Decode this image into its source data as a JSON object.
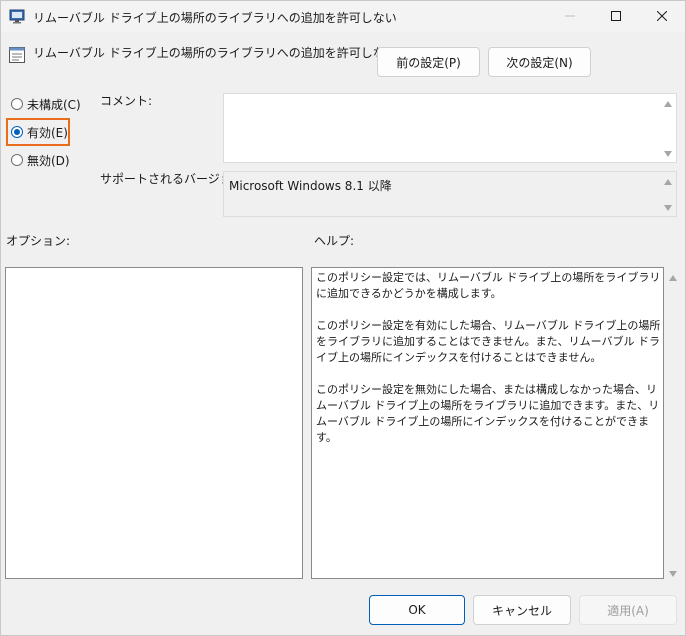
{
  "window": {
    "title": "リムーバブル ドライブ上の場所のライブラリへの追加を許可しない"
  },
  "header": {
    "policy_name": "リムーバブル ドライブ上の場所のライブラリへの追加を許可しない",
    "prev_button": "前の設定(P)",
    "next_button": "次の設定(N)"
  },
  "state": {
    "options": [
      {
        "label": "未構成(C)",
        "checked": false
      },
      {
        "label": "有効(E)",
        "checked": true
      },
      {
        "label": "無効(D)",
        "checked": false
      }
    ]
  },
  "fields": {
    "comment_label": "コメント:",
    "comment_value": "",
    "supported_label": "サポートされるバージョン:",
    "supported_value": "Microsoft Windows 8.1 以降"
  },
  "panels": {
    "options_label": "オプション:",
    "help_label": "ヘルプ:",
    "help_paragraphs": [
      "このポリシー設定では、リムーバブル ドライブ上の場所をライブラリに追加できるかどうかを構成します。",
      "このポリシー設定を有効にした場合、リムーバブル ドライブ上の場所をライブラリに追加することはできません。また、リムーバブル ドライブ上の場所にインデックスを付けることはできません。",
      "このポリシー設定を無効にした場合、または構成しなかった場合、リムーバブル ドライブ上の場所をライブラリに追加できます。また、リムーバブル ドライブ上の場所にインデックスを付けることができます。"
    ]
  },
  "footer": {
    "ok": "OK",
    "cancel": "キャンセル",
    "apply": "適用(A)"
  },
  "colors": {
    "accent": "#005fb8",
    "highlight": "#e96c1c"
  }
}
